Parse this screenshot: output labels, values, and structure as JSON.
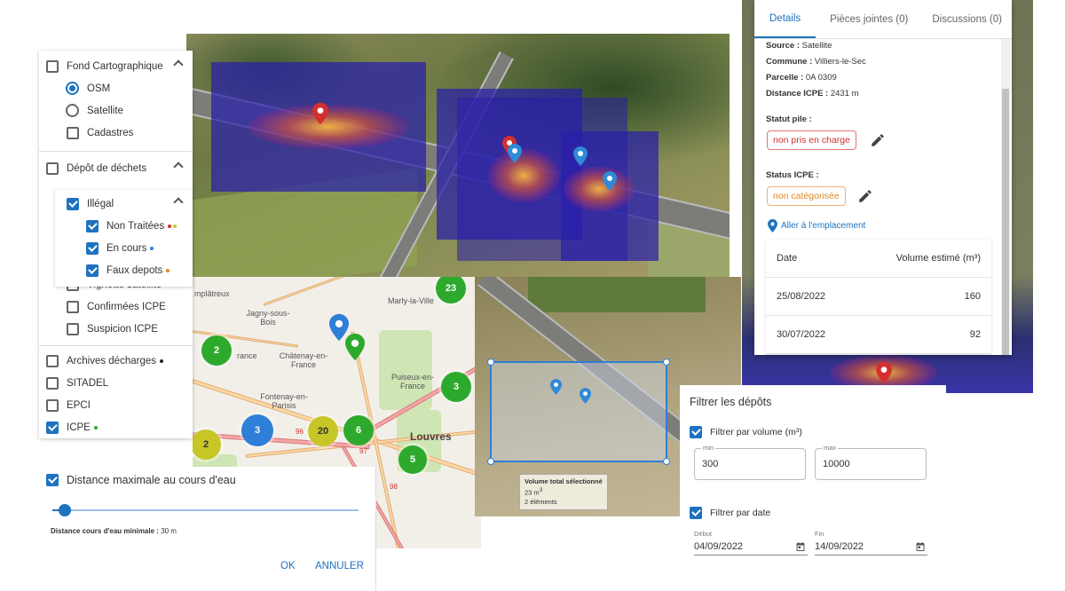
{
  "layers": {
    "fond_label": "Fond Cartographique",
    "osm_label": "OSM",
    "satellite_label": "Satellite",
    "cadastres_label": "Cadastres",
    "depot_label": "Dépôt de déchets",
    "illegal_label": "Illégal",
    "non_traitees_label": "Non Traitées",
    "en_cours_label": "En cours",
    "faux_depots_label": "Faux depots",
    "vignette_label": "Vignette satellite",
    "confirmees_label": "Confirmées ICPE",
    "suspicion_label": "Suspicion ICPE",
    "archives_label": "Archives décharges",
    "sitadel_label": "SITADEL",
    "epci_label": "EPCI",
    "icpe_label": "ICPE",
    "colors": {
      "red": "#d32f2f",
      "yellow": "#cbcb1c",
      "blue": "#2f7ed8",
      "orange": "#e08a1e",
      "black": "#222222",
      "green": "#2daa2d"
    }
  },
  "osm_map": {
    "towns": [
      "mplâtreux",
      "Jagny-sous-Bois",
      "Marly-la-Ville",
      "rance",
      "Châtenay-en-France",
      "Fontenay-en-Parisis",
      "Puiseux-en-France",
      "Louvres"
    ],
    "roads": [
      "96",
      "97",
      "98"
    ],
    "clusters": [
      "23",
      "2",
      "3",
      "3",
      "20",
      "6",
      "5",
      "2"
    ]
  },
  "selection": {
    "title": "Volume total sélectionné",
    "volume": "23 m",
    "volume_sup": "3",
    "count": "2 éléments"
  },
  "details": {
    "tabs": [
      "Details",
      "Pièces jointes (0)",
      "Discussions (0)"
    ],
    "source_label": "Source :",
    "source_value": "Satellite",
    "commune_label": "Commune :",
    "commune_value": "Villiers-le-Sec",
    "parcelle_label": "Parcelle :",
    "parcelle_value": "0A 0309",
    "distance_label": "Distance ICPE :",
    "distance_value": "2431 m",
    "statut_label": "Statut pile :",
    "statut_value": "non pris en charge",
    "icpe_label": "Status ICPE :",
    "icpe_value": "non catégorisée",
    "goto_label": "Aller à l'emplacement",
    "table_headers": [
      "Date",
      "Volume estimé (m³)"
    ],
    "rows": [
      {
        "date": "25/08/2022",
        "volume": "160"
      },
      {
        "date": "30/07/2022",
        "volume": "92"
      }
    ]
  },
  "filter": {
    "title": "Filtrer les dépôts",
    "volume_label": "Filtrer par volume (m³)",
    "min_label": "min",
    "min_value": "300",
    "max_label": "max",
    "max_value": "10000",
    "date_label": "Filtrer par date",
    "debut_label": "Début",
    "debut_value": "04/09/2022",
    "fin_label": "Fin",
    "fin_value": "14/09/2022"
  },
  "distance": {
    "title": "Distance maximale au cours d'eau",
    "min_label": "Distance cours d'eau minimale :",
    "min_value": "30 m",
    "slider_fraction": 0.04,
    "ok_label": "OK",
    "cancel_label": "ANNULER"
  }
}
